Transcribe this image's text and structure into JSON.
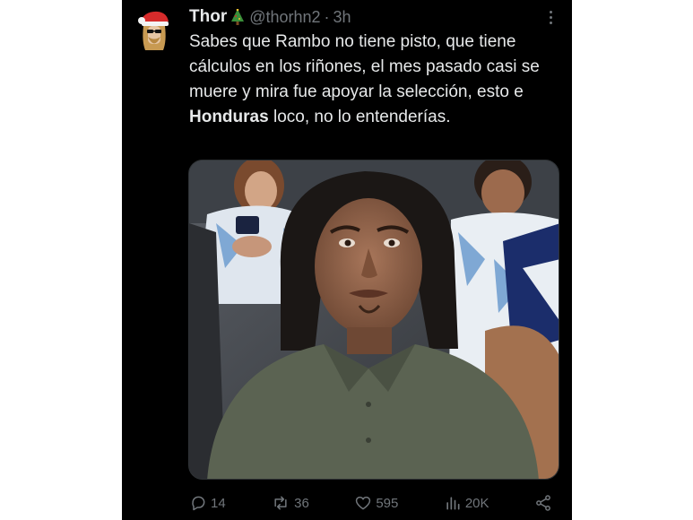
{
  "tweet": {
    "author": {
      "display_name": "Thor",
      "emoji": "christmas-tree",
      "handle": "@thorhn2"
    },
    "separator": "·",
    "time": "3h",
    "text": {
      "part1": "Sabes que Rambo no tiene pisto, que tiene cálculos en los riñones, el mes pasado casi se muere y mira fue apoyar la selección, esto e ",
      "bold": "Honduras",
      "part2": " loco, no lo entenderías."
    },
    "stats": {
      "replies": "14",
      "reposts": "36",
      "likes": "595",
      "views": "20K"
    }
  },
  "colors": {
    "background": "#000000",
    "text": "#e7e9ea",
    "secondary": "#71767b"
  }
}
